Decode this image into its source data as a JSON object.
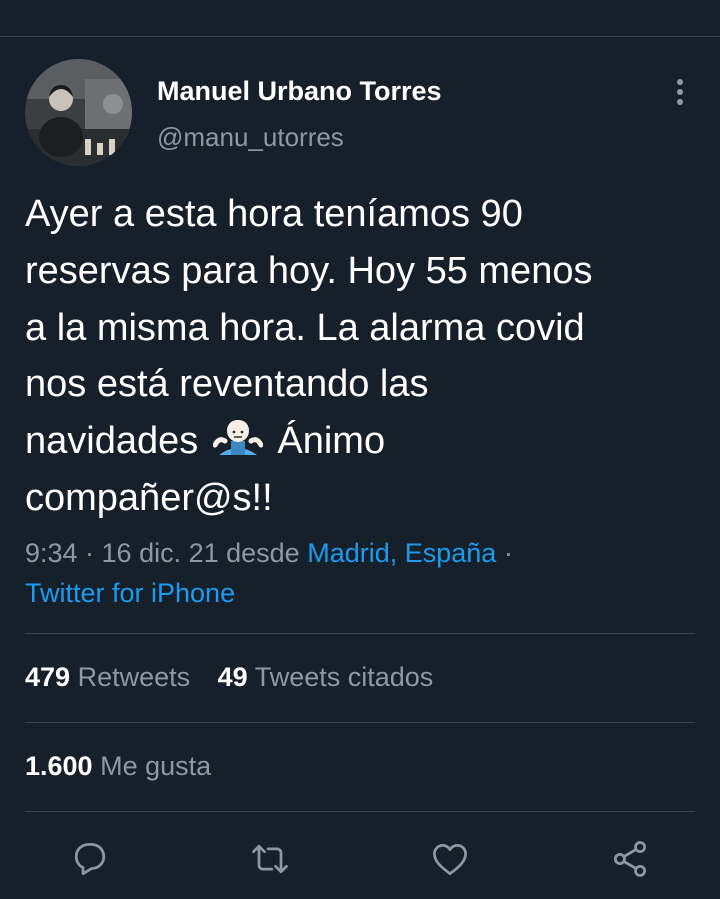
{
  "author": {
    "name": "Manuel Urbano Torres",
    "handle": "@manu_utorres"
  },
  "tweet": {
    "lines": [
      "Ayer a esta hora teníamos 90",
      "reservas para hoy. Hoy 55 menos",
      "a la misma hora. La alarma covid",
      "nos está reventando las",
      "navidades",
      "Ánimo",
      "compañer@s!!"
    ]
  },
  "meta": {
    "time_date": "9:34 · 16 dic. 21 desde ",
    "location": "Madrid, España",
    "separator": " ·",
    "source": "Twitter for iPhone"
  },
  "stats": {
    "retweets": {
      "count": "479",
      "label": "Retweets"
    },
    "quotes": {
      "count": "49",
      "label": "Tweets citados"
    },
    "likes": {
      "count": "1.600",
      "label": "Me gusta"
    }
  },
  "icons": {
    "more": "more-vertical-icon",
    "reply": "reply-icon",
    "retweet": "retweet-icon",
    "like": "heart-icon",
    "share": "share-icon",
    "emoji": "person-shrugging-emoji"
  },
  "colors": {
    "background": "#15202b",
    "text": "#ffffff",
    "muted": "#8b98a5",
    "link": "#1d9bf0",
    "divider": "#38444d"
  }
}
